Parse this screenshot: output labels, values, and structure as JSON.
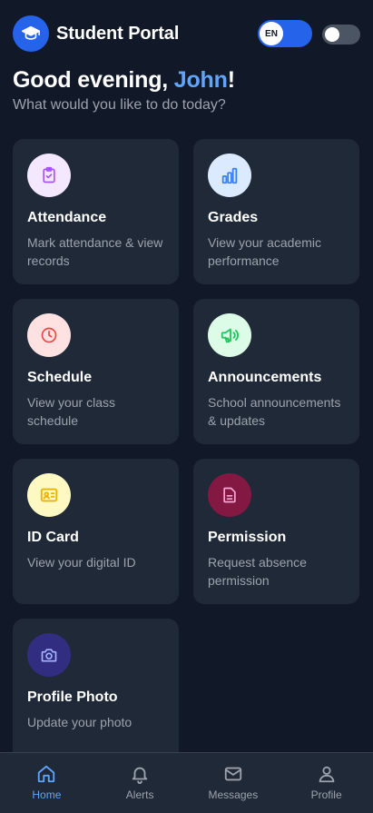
{
  "header": {
    "app_title": "Student Portal",
    "logo_icon": "graduation-cap-icon",
    "language_label": "EN",
    "theme_toggle_on": false
  },
  "greeting": {
    "prefix": "Good evening, ",
    "name": "John",
    "suffix": "!",
    "subtitle": "What would you like to do today?"
  },
  "cards": [
    {
      "title": "Attendance",
      "description": "Mark attendance & view records",
      "icon": "clipboard-check-icon",
      "icon_bg": "#f3e8ff",
      "icon_color": "#a855f7"
    },
    {
      "title": "Grades",
      "description": "View your academic performance",
      "icon": "bar-chart-icon",
      "icon_bg": "#dbeafe",
      "icon_color": "#3b82f6"
    },
    {
      "title": "Schedule",
      "description": "View your class schedule",
      "icon": "clock-icon",
      "icon_bg": "#fee2e2",
      "icon_color": "#ef4444"
    },
    {
      "title": "Announcements",
      "description": "School announcements & updates",
      "icon": "megaphone-icon",
      "icon_bg": "#dcfce7",
      "icon_color": "#22c55e"
    },
    {
      "title": "ID Card",
      "description": "View your digital ID",
      "icon": "id-card-icon",
      "icon_bg": "#fef9c3",
      "icon_color": "#eab308"
    },
    {
      "title": "Permission",
      "description": "Request absence permission",
      "icon": "document-icon",
      "icon_bg": "#831843",
      "icon_color": "#f9a8d4"
    },
    {
      "title": "Profile Photo",
      "description": "Update your photo",
      "icon": "camera-icon",
      "icon_bg": "#312e81",
      "icon_color": "#a5b4fc"
    }
  ],
  "bottom_nav": [
    {
      "label": "Home",
      "icon": "home-icon",
      "active": true
    },
    {
      "label": "Alerts",
      "icon": "bell-icon",
      "active": false
    },
    {
      "label": "Messages",
      "icon": "mail-icon",
      "active": false
    },
    {
      "label": "Profile",
      "icon": "user-icon",
      "active": false
    }
  ],
  "colors": {
    "background": "#111827",
    "card": "#1f2937",
    "accent": "#2563eb",
    "name_highlight": "#60a5fa"
  }
}
